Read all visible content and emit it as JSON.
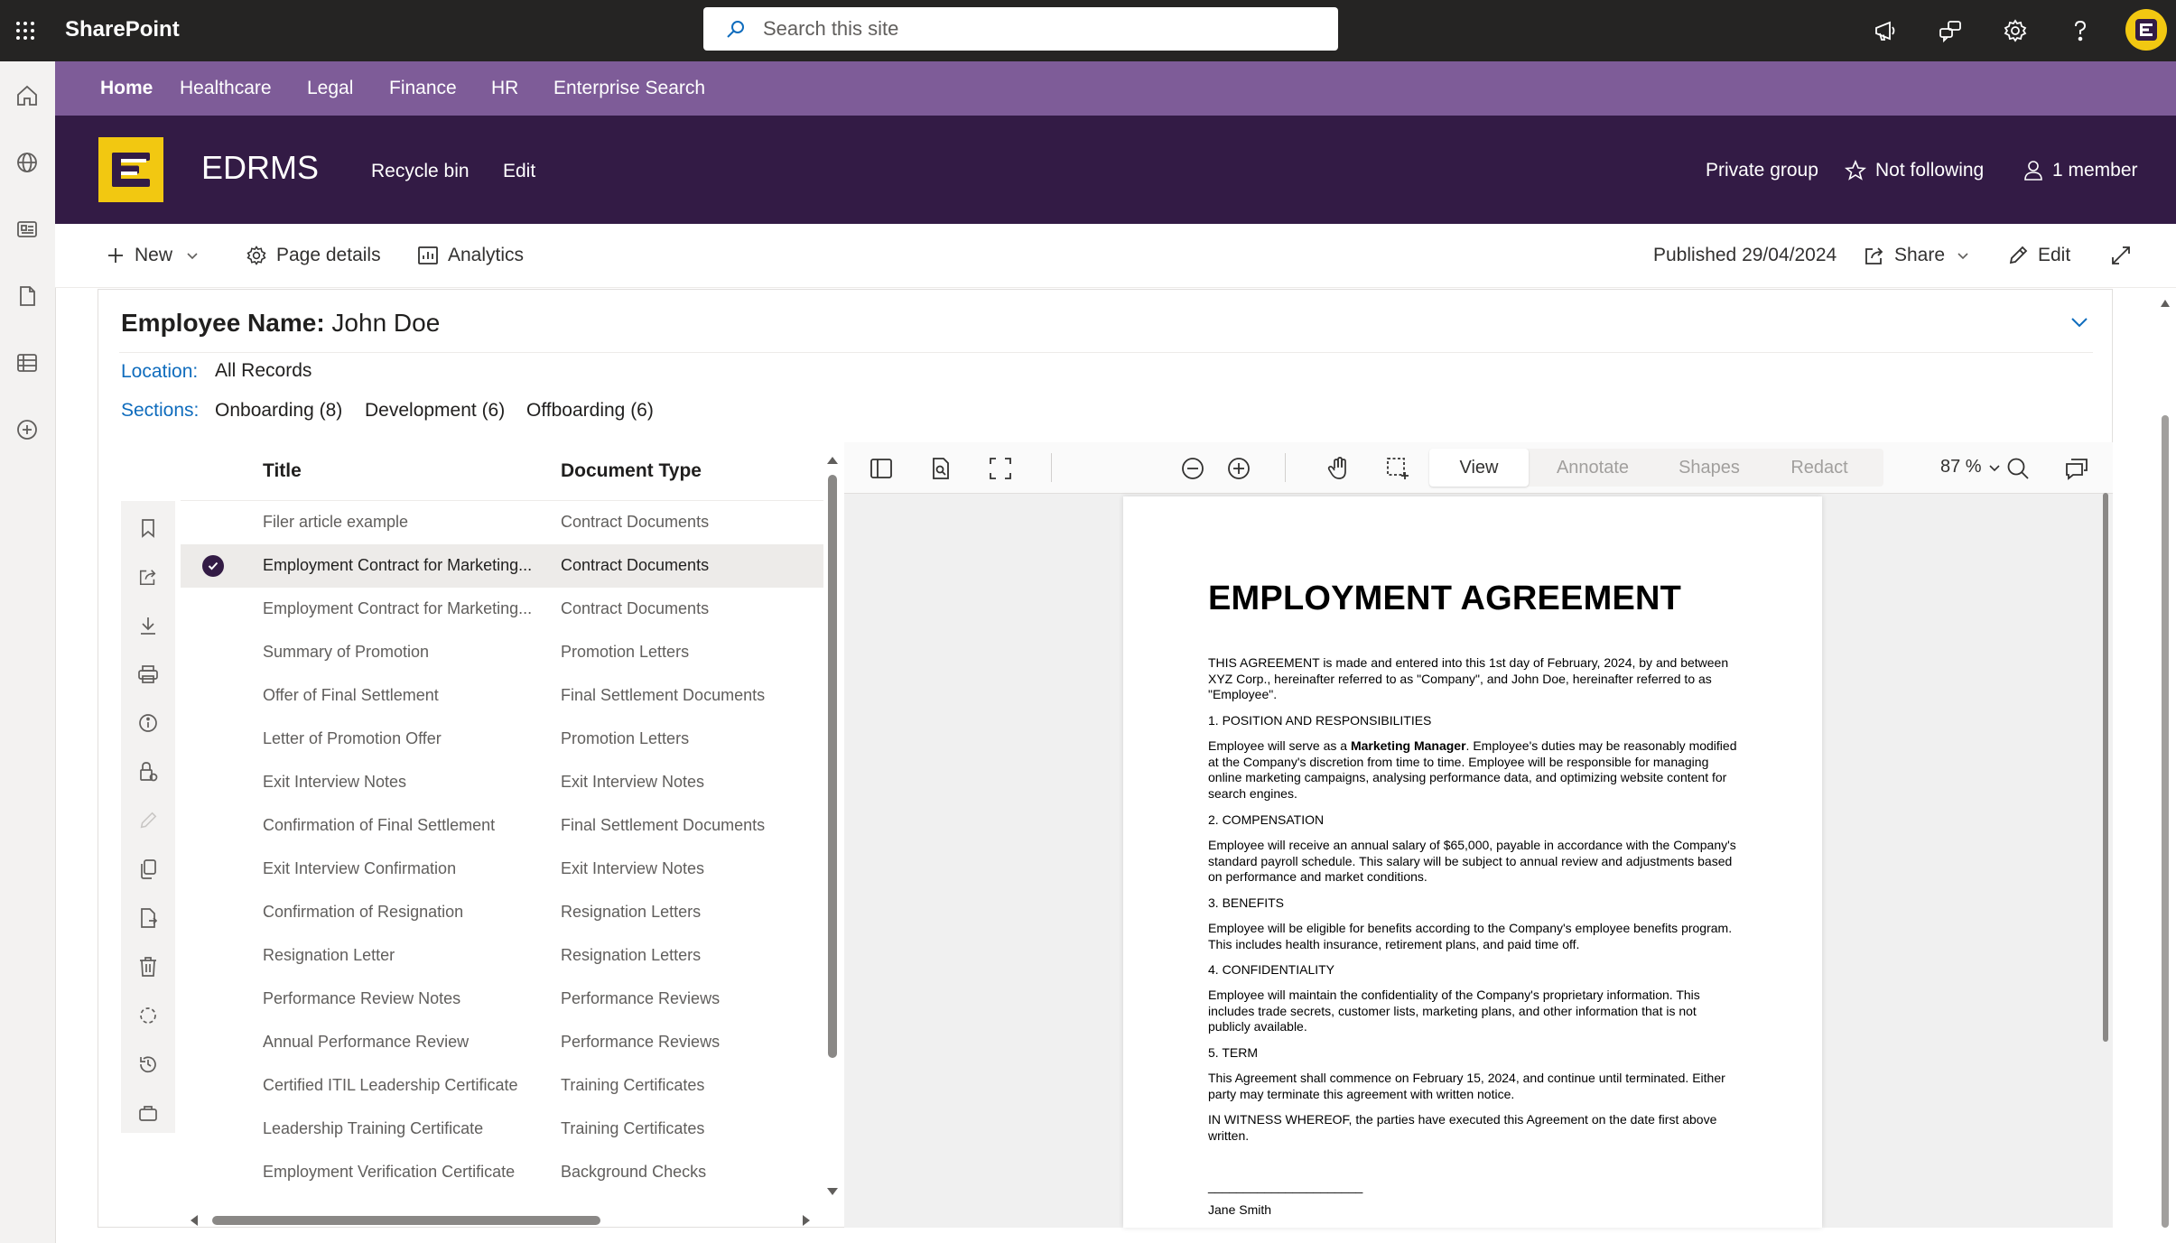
{
  "suite": {
    "brand": "SharePoint",
    "search_placeholder": "Search this site",
    "icons": [
      "app-launcher-icon",
      "megaphone-icon",
      "chat-share-icon",
      "settings-icon",
      "help-icon",
      "avatar"
    ]
  },
  "hub_nav": {
    "items": [
      "Home",
      "Healthcare",
      "Legal",
      "Finance",
      "HR",
      "Enterprise Search"
    ]
  },
  "site": {
    "title": "EDRMS",
    "links": [
      "Recycle bin",
      "Edit"
    ],
    "privacy": "Private group",
    "follow": "Not following",
    "members": "1 member"
  },
  "command_bar": {
    "new_label": "New",
    "page_details_label": "Page details",
    "analytics_label": "Analytics",
    "published": "Published 29/04/2024",
    "share_label": "Share",
    "edit_label": "Edit"
  },
  "record": {
    "employee_key": "Employee Name:",
    "employee_value": "John Doe",
    "location_key": "Location:",
    "location_value": "All Records",
    "sections_key": "Sections:",
    "sections": [
      "Onboarding (8)",
      "Development (6)",
      "Offboarding (6)"
    ]
  },
  "list": {
    "columns": [
      "Title",
      "Document Type"
    ],
    "rows": [
      {
        "title": "Filer article example",
        "type": "Contract Documents"
      },
      {
        "title": "Employment Contract for Marketing...",
        "type": "Contract Documents",
        "selected": true
      },
      {
        "title": "Employment Contract for Marketing...",
        "type": "Contract Documents"
      },
      {
        "title": "Summary of Promotion",
        "type": "Promotion Letters"
      },
      {
        "title": "Offer of Final Settlement",
        "type": "Final Settlement Documents"
      },
      {
        "title": "Letter of Promotion Offer",
        "type": "Promotion Letters"
      },
      {
        "title": "Exit Interview Notes",
        "type": "Exit Interview Notes"
      },
      {
        "title": "Confirmation of Final Settlement",
        "type": "Final Settlement Documents"
      },
      {
        "title": "Exit Interview Confirmation",
        "type": "Exit Interview Notes"
      },
      {
        "title": "Confirmation of Resignation",
        "type": "Resignation Letters"
      },
      {
        "title": "Resignation Letter",
        "type": "Resignation Letters"
      },
      {
        "title": "Performance Review Notes",
        "type": "Performance Reviews"
      },
      {
        "title": "Annual Performance Review",
        "type": "Performance Reviews"
      },
      {
        "title": "Certified ITIL Leadership Certificate",
        "type": "Training Certificates"
      },
      {
        "title": "Leadership Training Certificate",
        "type": "Training Certificates"
      },
      {
        "title": "Employment Verification Certificate",
        "type": "Background Checks"
      }
    ]
  },
  "viewer": {
    "zoom": "87 %",
    "modes": [
      "View",
      "Annotate",
      "Shapes",
      "Redact"
    ],
    "active_mode": "View"
  },
  "document": {
    "title": "EMPLOYMENT AGREEMENT",
    "paragraphs": [
      "THIS AGREEMENT is made and entered into this 1st day of February, 2024, by and between XYZ Corp., hereinafter referred to as \"Company\", and John Doe, hereinafter referred to as \"Employee\".",
      "1. POSITION AND RESPONSIBILITIES",
      "Employee will serve as a",
      "Marketing Manager",
      ". Employee's duties may be reasonably modified at the Company's discretion from time to time. Employee will be responsible for managing online marketing campaigns, analysing performance data, and optimizing website content for search engines.",
      "2. COMPENSATION",
      "Employee will receive an annual salary of $65,000, payable in accordance with the Company's standard payroll schedule. This salary will be subject to annual review and adjustments based on performance and market conditions.",
      "3. BENEFITS",
      "Employee will be eligible for benefits according to the Company's employee benefits program. This includes health insurance, retirement plans, and paid time off.",
      "4. CONFIDENTIALITY",
      "Employee will maintain the confidentiality of the Company's proprietary information. This includes trade secrets, customer lists, marketing plans, and other information that is not publicly available.",
      "5. TERM",
      "This Agreement shall commence on February 15, 2024, and continue until terminated. Either party may terminate this agreement with written notice.",
      "IN WITNESS WHEREOF, the parties have executed this Agreement on the date first above written.",
      "______________________",
      "Jane Smith"
    ]
  },
  "colors": {
    "suite_bar": "#252423",
    "hub_nav": "#7e5c98",
    "site_header": "#331b45",
    "logo": "#f2c811",
    "link_blue": "#0f6cbd"
  }
}
